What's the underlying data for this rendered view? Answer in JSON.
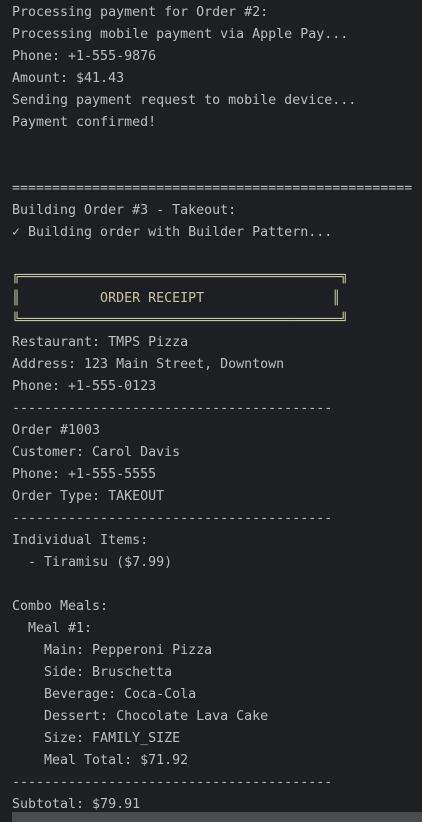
{
  "console": {
    "lines": [
      "Processing payment for Order #2:",
      "Processing mobile payment via Apple Pay...",
      "Phone: +1-555-9876",
      "Amount: $41.43",
      "Sending payment request to mobile device...",
      "Payment confirmed!",
      "",
      "",
      "==================================================",
      "Building Order #3 - Takeout:",
      "✓ Building order with Builder Pattern...",
      "",
      "╔════════════════════════════════════════╗",
      "║          ORDER RECEIPT                ║",
      "╚════════════════════════════════════════╝",
      "Restaurant: TMPS Pizza",
      "Address: 123 Main Street, Downtown",
      "Phone: +1-555-0123",
      "----------------------------------------",
      "Order #1003",
      "Customer: Carol Davis",
      "Phone: +1-555-5555",
      "Order Type: TAKEOUT",
      "----------------------------------------",
      "Individual Items:",
      "  - Tiramisu ($7.99)",
      "",
      "Combo Meals:",
      "  Meal #1:",
      "    Main: Pepperoni Pizza",
      "    Side: Bruschetta",
      "    Beverage: Coca-Cola",
      "    Dessert: Chocolate Lava Cake",
      "    Size: FAMILY_SIZE",
      "    Meal Total: $71.92",
      "----------------------------------------",
      "Subtotal: $79.91"
    ]
  }
}
